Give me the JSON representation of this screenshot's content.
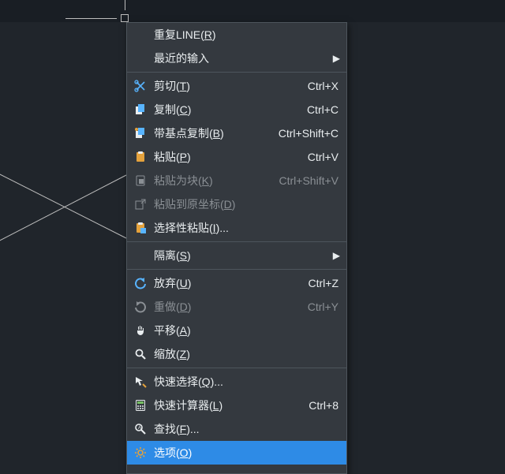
{
  "colors": {
    "canvas_bg": "#20252b",
    "menu_bg": "#34393f",
    "highlight": "#2e8be6"
  },
  "cursor": {
    "semantic": "crosshair-cursor"
  },
  "menu": {
    "items": [
      {
        "icon": null,
        "label": "重复LINE(R)",
        "hotkey": "R",
        "shortcut": "",
        "sub": false,
        "disabled": false,
        "highlight": false
      },
      {
        "icon": null,
        "label": "最近的输入",
        "hotkey": "",
        "shortcut": "",
        "sub": true,
        "disabled": false,
        "highlight": false
      },
      {
        "sep": true
      },
      {
        "icon": "scissors",
        "label": "剪切(T)",
        "hotkey": "T",
        "shortcut": "Ctrl+X",
        "sub": false,
        "disabled": false,
        "highlight": false
      },
      {
        "icon": "copy",
        "label": "复制(C)",
        "hotkey": "C",
        "shortcut": "Ctrl+C",
        "sub": false,
        "disabled": false,
        "highlight": false
      },
      {
        "icon": "copybase",
        "label": "带基点复制(B)",
        "hotkey": "B",
        "shortcut": "Ctrl+Shift+C",
        "sub": false,
        "disabled": false,
        "highlight": false
      },
      {
        "icon": "paste",
        "label": "粘贴(P)",
        "hotkey": "P",
        "shortcut": "Ctrl+V",
        "sub": false,
        "disabled": false,
        "highlight": false
      },
      {
        "icon": "pasteblock",
        "label": "粘贴为块(K)",
        "hotkey": "K",
        "shortcut": "Ctrl+Shift+V",
        "sub": false,
        "disabled": true,
        "highlight": false
      },
      {
        "icon": "pasteorig",
        "label": "粘贴到原坐标(D)",
        "hotkey": "D",
        "shortcut": "",
        "sub": false,
        "disabled": true,
        "highlight": false
      },
      {
        "icon": "pastespecial",
        "label": "选择性粘贴(I)...",
        "hotkey": "I",
        "shortcut": "",
        "sub": false,
        "disabled": false,
        "highlight": false
      },
      {
        "sep": true
      },
      {
        "icon": null,
        "label": "隔离(S)",
        "hotkey": "S",
        "shortcut": "",
        "sub": true,
        "disabled": false,
        "highlight": false
      },
      {
        "sep": true
      },
      {
        "icon": "undo",
        "label": "放弃(U)",
        "hotkey": "U",
        "shortcut": "Ctrl+Z",
        "sub": false,
        "disabled": false,
        "highlight": false
      },
      {
        "icon": "redo",
        "label": "重做(D)",
        "hotkey": "D",
        "shortcut": "Ctrl+Y",
        "sub": false,
        "disabled": true,
        "highlight": false
      },
      {
        "icon": "pan",
        "label": "平移(A)",
        "hotkey": "A",
        "shortcut": "",
        "sub": false,
        "disabled": false,
        "highlight": false
      },
      {
        "icon": "zoom",
        "label": "缩放(Z)",
        "hotkey": "Z",
        "shortcut": "",
        "sub": false,
        "disabled": false,
        "highlight": false
      },
      {
        "sep": true
      },
      {
        "icon": "quickselect",
        "label": "快速选择(Q)...",
        "hotkey": "Q",
        "shortcut": "",
        "sub": false,
        "disabled": false,
        "highlight": false
      },
      {
        "icon": "calc",
        "label": "快速计算器(L)",
        "hotkey": "L",
        "shortcut": "Ctrl+8",
        "sub": false,
        "disabled": false,
        "highlight": false
      },
      {
        "icon": "find",
        "label": "查找(F)...",
        "hotkey": "F",
        "shortcut": "",
        "sub": false,
        "disabled": false,
        "highlight": false
      },
      {
        "icon": "options",
        "label": "选项(O)",
        "hotkey": "O",
        "shortcut": "",
        "sub": false,
        "disabled": false,
        "highlight": true
      }
    ]
  }
}
